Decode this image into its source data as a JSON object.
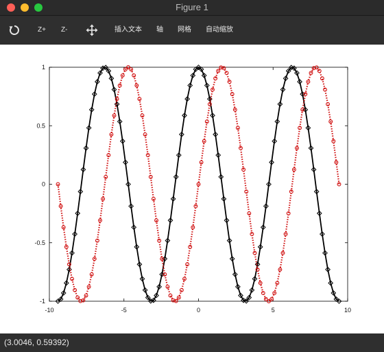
{
  "window": {
    "title": "Figure 1"
  },
  "toolbar": {
    "reset_icon": "refresh-icon",
    "zoom_in_label": "Z+",
    "zoom_out_label": "Z-",
    "pan_icon": "move-arrows-icon",
    "insert_text_label": "插入文本",
    "axis_label": "轴",
    "grid_label": "网格",
    "autoscale_label": "自动缩放"
  },
  "status": {
    "coords": "(3.0046, 0.59392)"
  },
  "chart_data": {
    "type": "line",
    "xlim": [
      -10,
      10
    ],
    "ylim": [
      -1,
      1
    ],
    "xticks": [
      -10,
      -5,
      0,
      5,
      10
    ],
    "yticks": [
      -1,
      -0.5,
      0,
      0.5,
      1
    ],
    "grid": false,
    "x_range": [
      -9.42478,
      9.42478
    ],
    "points_per_series": 101,
    "series": [
      {
        "function": "cos(x)",
        "color": "#000000",
        "line_style": "solid",
        "marker": "diamond"
      },
      {
        "function": "sin(x)",
        "color": "#d01010",
        "line_style": "dotted",
        "marker": "circle"
      }
    ]
  }
}
